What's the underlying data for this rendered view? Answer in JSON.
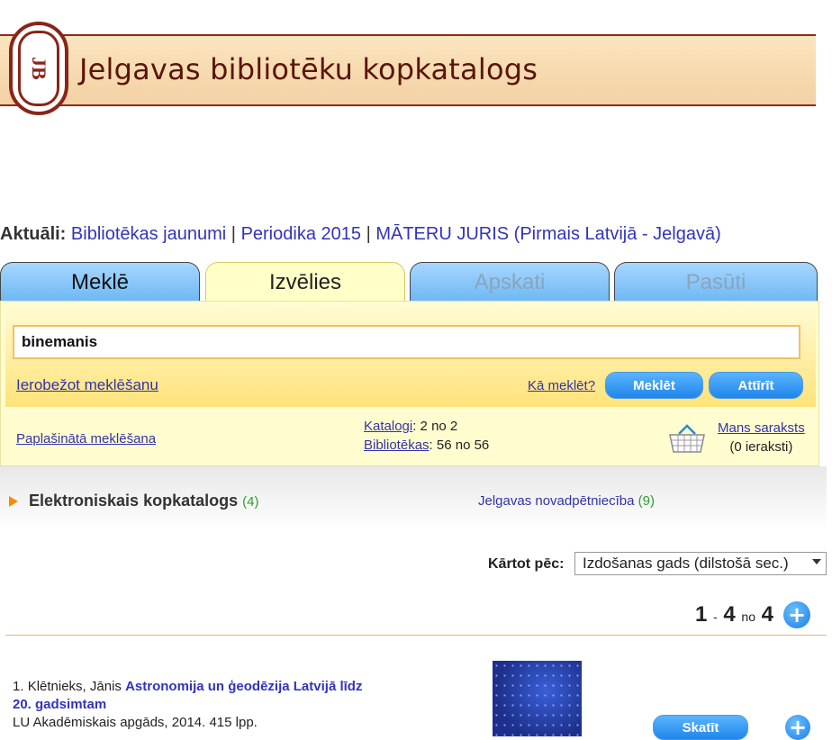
{
  "header": {
    "title": "Jelgavas bibliotēku kopkatalogs",
    "logo_letters": "JB"
  },
  "news": {
    "label": "Aktuāli:",
    "links": [
      "Bibliotēkas jaunumi",
      "Periodika 2015",
      "MĀTERU JURIS (Pirmais Latvijā - Jelgavā)"
    ],
    "separator": "|"
  },
  "tabs": [
    {
      "label": "Meklē",
      "state": "normal"
    },
    {
      "label": "Izvēlies",
      "state": "active"
    },
    {
      "label": "Apskati",
      "state": "disabled"
    },
    {
      "label": "Pasūti",
      "state": "disabled"
    }
  ],
  "search": {
    "query": "binemanis",
    "limit_link": "Ierobežot meklēšanu",
    "how_link": "Kā meklēt?",
    "search_button": "Meklēt",
    "clear_button": "Attīrīt",
    "advanced_link": "Paplašinātā meklēšana",
    "catalogs_label": "Katalogi",
    "catalogs_value": ": 2 no 2",
    "libraries_label": "Bibliotēkas",
    "libraries_value": ": 56 no 56",
    "my_list_link": "Mans saraksts",
    "my_list_count": "(0 ieraksti)"
  },
  "catalog_tabs": {
    "primary_label": "Elektroniskais kopkatalogs",
    "primary_count": "(4)",
    "secondary_label": "Jelgavas novadpētniecība",
    "secondary_count": "(9)"
  },
  "sort": {
    "label": "Kārtot pēc:",
    "selected": "Izdošanas gads (dilstošā sec.)"
  },
  "pager": {
    "from": "1",
    "dash": "-",
    "to": "4",
    "of": "no",
    "total": "4"
  },
  "results": [
    {
      "number": "1.",
      "author": "Klētnieks, Jānis",
      "title": "Astronomija un ģeodēzija Latvijā līdz 20. gadsimtam",
      "publisher": "LU Akadēmiskais apgāds, 2014. 415 lpp.",
      "view_button": "Skatīt"
    }
  ],
  "colors": {
    "tab_blue": "#6cb8f4",
    "tab_active": "#ffffc8",
    "accent_orange": "#f28c00",
    "link": "#3333bb",
    "brand": "#8a2418"
  }
}
